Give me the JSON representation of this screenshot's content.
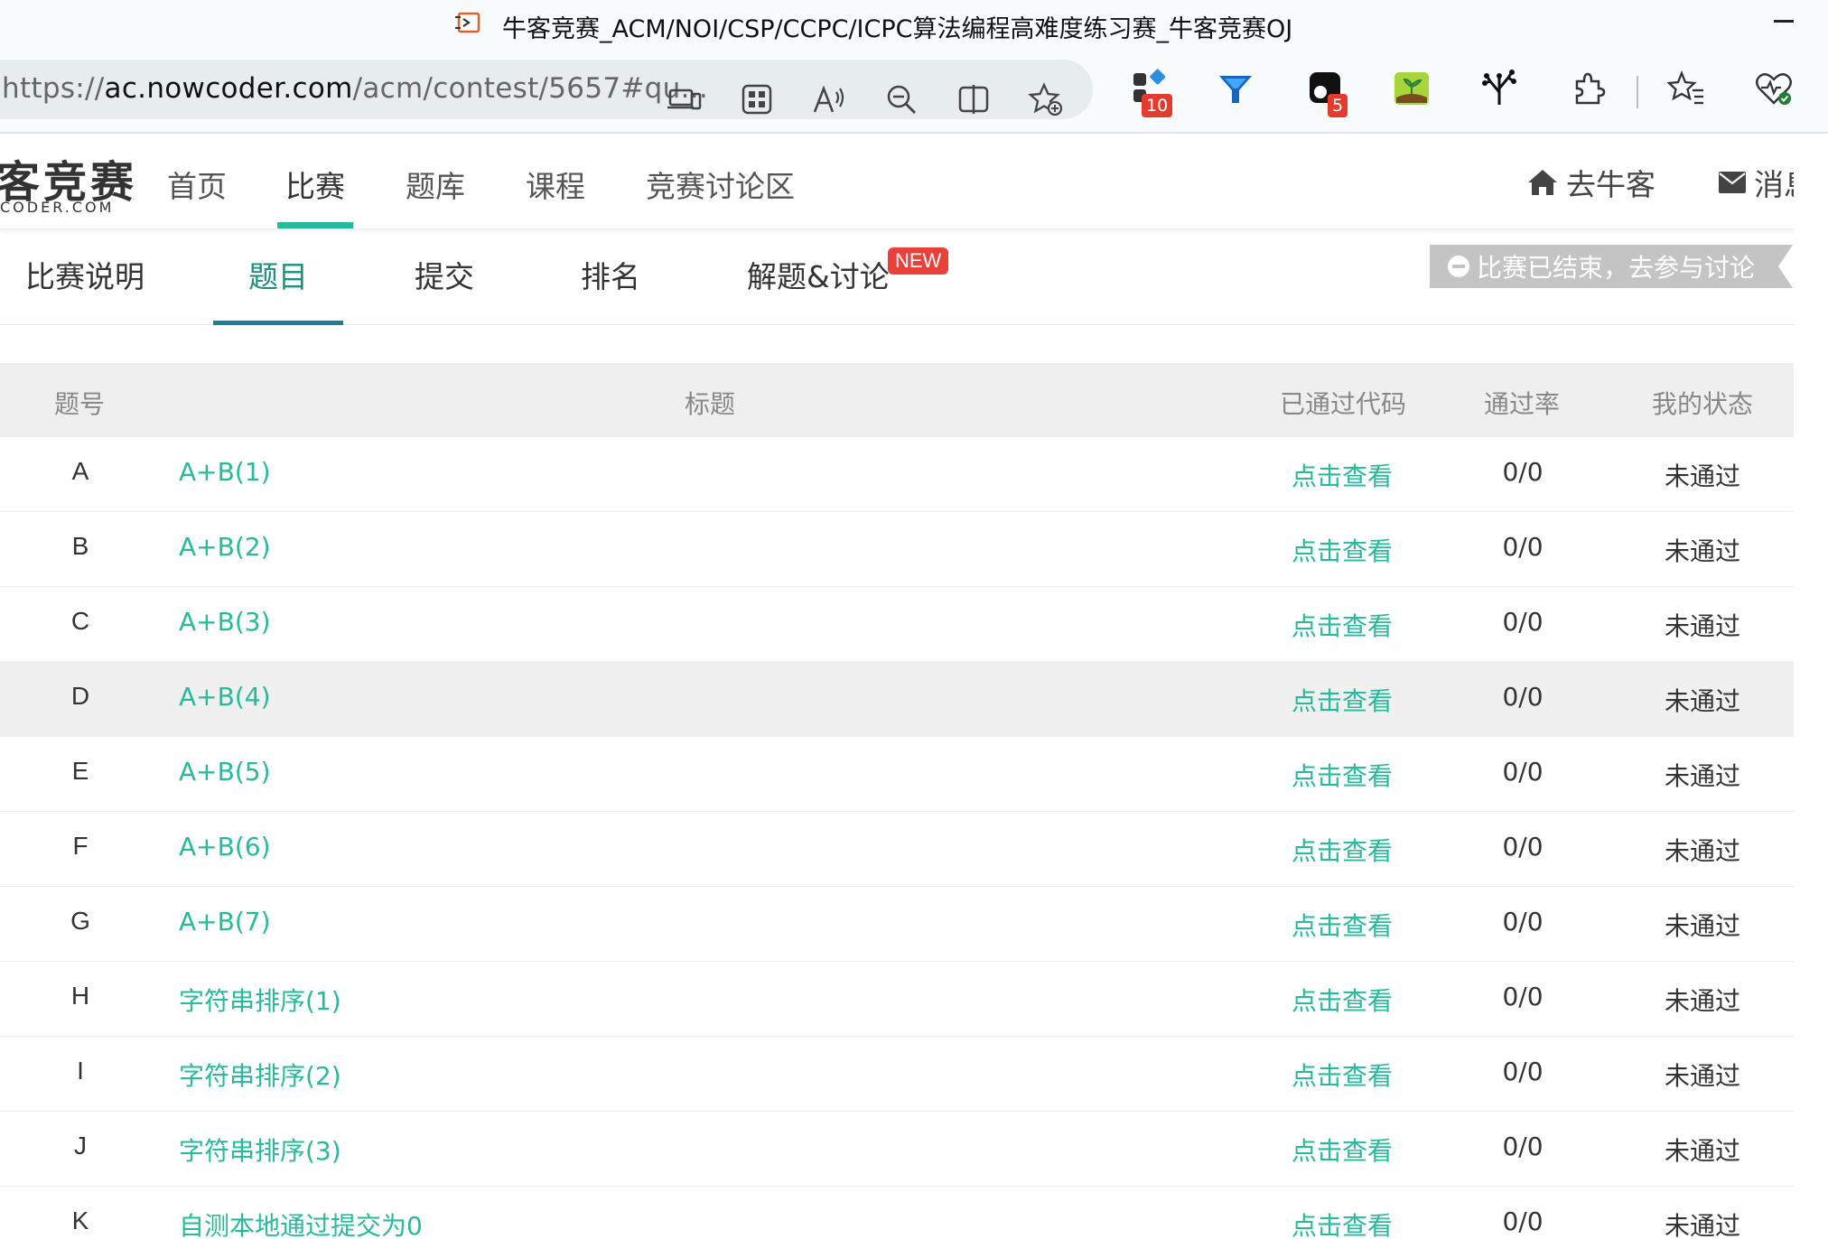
{
  "browser": {
    "window_title": "牛客竞赛_ACM/NOI/CSP/CCPC/ICPC算法编程高难度练习赛_牛客竞赛OJ",
    "url_prefix": "https://",
    "url_host": "ac.nowcoder.com",
    "url_path": "/acm/contest/5657#qu...",
    "icons": [
      "app-available-icon",
      "apps-grid-icon",
      "read-aloud-icon",
      "zoom-out-icon",
      "split-screen-icon",
      "add-favorite-icon"
    ],
    "extensions": [
      {
        "name": "extension-puzzle-blocks-icon",
        "badge": "10"
      },
      {
        "name": "extension-funnel-icon",
        "badge": ""
      },
      {
        "name": "extension-dark-reader-icon",
        "badge": "5"
      },
      {
        "name": "extension-sprout-icon",
        "badge": ""
      },
      {
        "name": "extension-tree-icon",
        "badge": ""
      },
      {
        "name": "extensions-icon",
        "badge": ""
      }
    ],
    "favorites_icon": "favorites-icon",
    "health_icon": "browser-essentials-icon"
  },
  "site": {
    "logo_text": "客竞赛",
    "logo_sub": "CODER.COM",
    "nav": [
      "首页",
      "比赛",
      "题库",
      "课程",
      "竞赛讨论区"
    ],
    "active_nav": "比赛",
    "go_nowcoder": "去牛客",
    "messages": "消息",
    "accent": "#25bb9b"
  },
  "contest_tabs": {
    "items": [
      "比赛说明",
      "题目",
      "提交",
      "排名",
      "解题&讨论"
    ],
    "active": "题目",
    "new_badge": "NEW",
    "ended_notice": "比赛已结束，去参与讨论"
  },
  "problems": {
    "headers": {
      "id": "题号",
      "title": "标题",
      "passed_code": "已通过代码",
      "pass_rate": "通过率",
      "my_status": "我的状态"
    },
    "rows": [
      {
        "id": "A",
        "title": "A+B(1)",
        "view": "点击查看",
        "rate": "0/0",
        "status": "未通过"
      },
      {
        "id": "B",
        "title": "A+B(2)",
        "view": "点击查看",
        "rate": "0/0",
        "status": "未通过"
      },
      {
        "id": "C",
        "title": "A+B(3)",
        "view": "点击查看",
        "rate": "0/0",
        "status": "未通过"
      },
      {
        "id": "D",
        "title": "A+B(4)",
        "view": "点击查看",
        "rate": "0/0",
        "status": "未通过"
      },
      {
        "id": "E",
        "title": "A+B(5)",
        "view": "点击查看",
        "rate": "0/0",
        "status": "未通过"
      },
      {
        "id": "F",
        "title": "A+B(6)",
        "view": "点击查看",
        "rate": "0/0",
        "status": "未通过"
      },
      {
        "id": "G",
        "title": "A+B(7)",
        "view": "点击查看",
        "rate": "0/0",
        "status": "未通过"
      },
      {
        "id": "H",
        "title": "字符串排序(1)",
        "view": "点击查看",
        "rate": "0/0",
        "status": "未通过"
      },
      {
        "id": "I",
        "title": "字符串排序(2)",
        "view": "点击查看",
        "rate": "0/0",
        "status": "未通过"
      },
      {
        "id": "J",
        "title": "字符串排序(3)",
        "view": "点击查看",
        "rate": "0/0",
        "status": "未通过"
      },
      {
        "id": "K",
        "title": "自测本地通过提交为0",
        "view": "点击查看",
        "rate": "0/0",
        "status": "未通过"
      }
    ],
    "hovered_row": "D"
  }
}
